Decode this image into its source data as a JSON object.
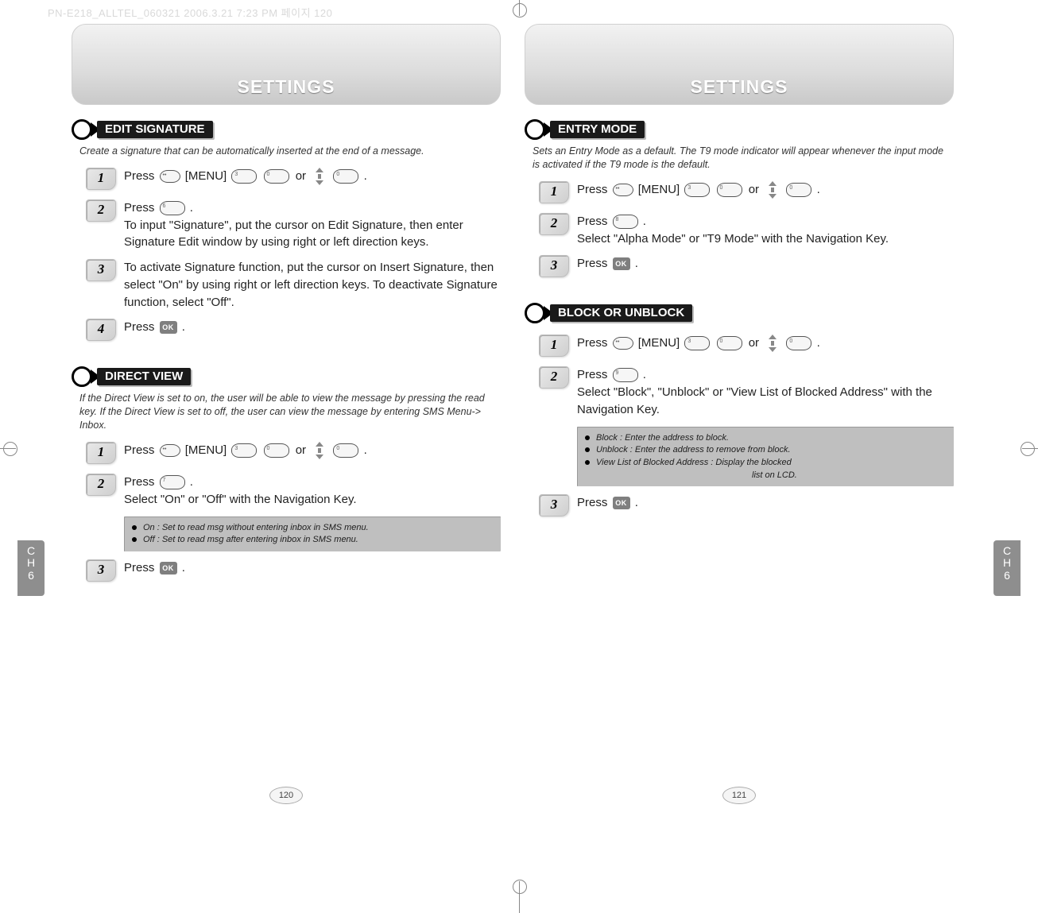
{
  "print_header": "PN-E218_ALLTEL_060321  2006.3.21 7:23 PM  페이지 120",
  "page_left": {
    "header": "SETTINGS",
    "chapter_tab": {
      "line1": "C",
      "line2": "H",
      "line3": "6"
    },
    "page_number": "120",
    "sections": [
      {
        "title": "EDIT SIGNATURE",
        "desc": "Create a signature that can be automatically inserted at the end of a message.",
        "steps": [
          {
            "n": "1",
            "text_before": "Press ",
            "menu_label": " [MENU] ",
            "text_mid": "or  ",
            "text_after": ".",
            "keys_after_menu": [
              "3",
              "0"
            ],
            "nav": true,
            "keys_after_nav": [
              "0"
            ]
          },
          {
            "n": "2",
            "text_before": "Press ",
            "keys_inline": [
              "6"
            ],
            "text_after": " .",
            "extra": "To input \"Signature\", put the cursor on Edit Signature, then enter Signature Edit window by using right or left direction keys."
          },
          {
            "n": "3",
            "extra": "To activate Signature function, put the cursor on Insert Signature, then select \"On\" by using right or left direction keys. To deactivate Signature function, select \"Off\"."
          },
          {
            "n": "4",
            "text_before": "Press ",
            "ok": true,
            "text_after": " ."
          }
        ]
      },
      {
        "title": "DIRECT VIEW",
        "desc": "If the Direct View is set to on, the user will be able to view the message by pressing the read key. If the Direct View is set to off, the user can view the message by entering SMS Menu-> Inbox.",
        "steps": [
          {
            "n": "1",
            "text_before": "Press ",
            "menu_label": " [MENU] ",
            "text_mid": "or  ",
            "text_after": ".",
            "keys_after_menu": [
              "3",
              "0"
            ],
            "nav": true,
            "keys_after_nav": [
              "0"
            ]
          },
          {
            "n": "2",
            "text_before": "Press ",
            "keys_inline": [
              "7"
            ],
            "text_after": " .",
            "extra": "Select \"On\" or \"Off\" with the Navigation Key."
          }
        ],
        "infobox": [
          "On : Set to read msg without entering inbox in SMS menu.",
          "Off : Set to read msg after entering inbox in SMS menu."
        ],
        "steps_after": [
          {
            "n": "3",
            "text_before": "Press ",
            "ok": true,
            "text_after": " ."
          }
        ]
      }
    ]
  },
  "page_right": {
    "header": "SETTINGS",
    "chapter_tab": {
      "line1": "C",
      "line2": "H",
      "line3": "6"
    },
    "page_number": "121",
    "sections": [
      {
        "title": "ENTRY MODE",
        "desc": "Sets an Entry Mode as a default. The T9 mode indicator will appear whenever the input mode is activated if the T9 mode is the default.",
        "steps": [
          {
            "n": "1",
            "text_before": "Press ",
            "menu_label": " [MENU] ",
            "text_mid": "or  ",
            "text_after": ".",
            "keys_after_menu": [
              "3",
              "0"
            ],
            "nav": true,
            "keys_after_nav": [
              "0"
            ]
          },
          {
            "n": "2",
            "text_before": "Press ",
            "keys_inline": [
              "8"
            ],
            "text_after": " .",
            "extra": "Select \"Alpha Mode\" or \"T9 Mode\" with the Navigation Key."
          },
          {
            "n": "3",
            "text_before": "Press ",
            "ok": true,
            "text_after": " ."
          }
        ]
      },
      {
        "title": "BLOCK OR UNBLOCK",
        "desc": "",
        "steps": [
          {
            "n": "1",
            "text_before": "Press ",
            "menu_label": " [MENU] ",
            "text_mid": "or  ",
            "text_after": ".",
            "keys_after_menu": [
              "3",
              "0"
            ],
            "nav": true,
            "keys_after_nav": [
              "0"
            ]
          },
          {
            "n": "2",
            "text_before": "Press ",
            "keys_inline": [
              "9"
            ],
            "text_after": " .",
            "extra": "Select \"Block\", \"Unblock\" or \"View List of Blocked Address\" with the Navigation Key."
          }
        ],
        "infobox": [
          "Block : Enter the address to block.",
          "Unblock : Enter the address to remove from block.",
          "View List of Blocked Address : Display the blocked"
        ],
        "infobox_tail": "list on LCD.",
        "steps_after": [
          {
            "n": "3",
            "text_before": "Press ",
            "ok": true,
            "text_after": " ."
          }
        ]
      }
    ]
  }
}
